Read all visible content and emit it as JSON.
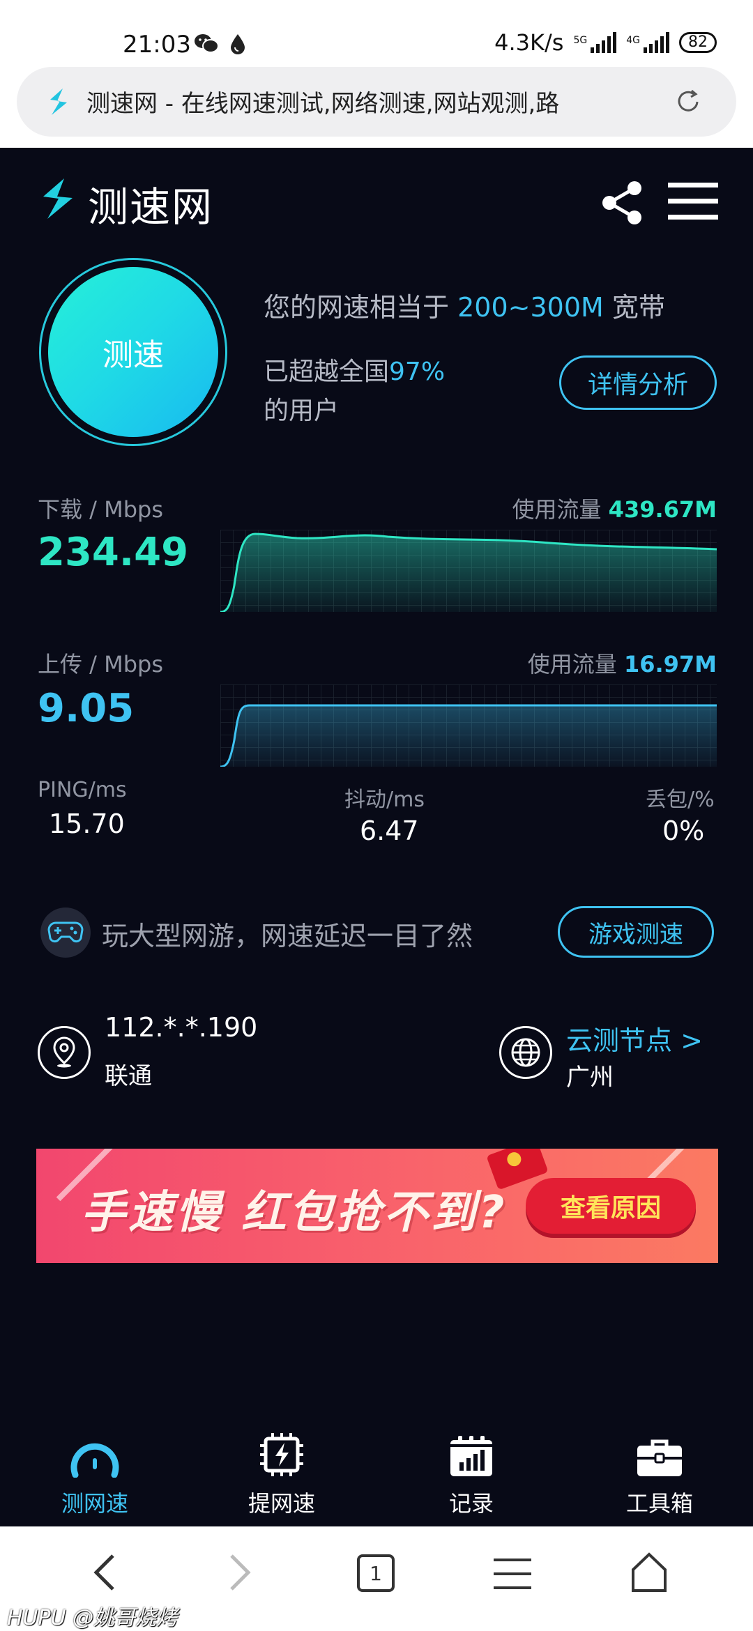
{
  "status_bar": {
    "time": "21:03",
    "net_speed": "4.3K/s",
    "sim1_label": "5G",
    "sim2_label": "4G",
    "battery": "82",
    "icons": [
      "wechat-icon",
      "drop-icon",
      "signal-icon",
      "battery-icon"
    ]
  },
  "browser": {
    "url_text": "测速网 - 在线网速测试,网络测速,网站观测,路",
    "icons": [
      "favicon",
      "reload-icon"
    ]
  },
  "header": {
    "brand": "测速网",
    "icons": [
      "share-icon",
      "menu-icon"
    ]
  },
  "speed_test": {
    "button_label": "测速",
    "equivalent_prefix": "您的网速相当于 ",
    "equivalent_value": "200~300M",
    "equivalent_suffix": " 宽带",
    "beat_prefix": "已超越全国",
    "beat_value": "97%",
    "beat_suffix": "的用户",
    "detail_button": "详情分析"
  },
  "download": {
    "label": "下载 / Mbps",
    "value": "234.49",
    "usage_label": "使用流量 ",
    "usage_value": "439.67M",
    "color": "#2ee6c4"
  },
  "upload": {
    "label": "上传 / Mbps",
    "value": "9.05",
    "usage_label": "使用流量 ",
    "usage_value": "16.97M",
    "color": "#3fc3f2"
  },
  "stats": {
    "ping_label": "PING/ms",
    "ping_value": "15.70",
    "jitter_label": "抖动/ms",
    "jitter_value": "6.47",
    "loss_label": "丢包/%",
    "loss_value": "0%"
  },
  "game": {
    "text": "玩大型网游，网速延迟一目了然",
    "button": "游戏测速",
    "icon": "gamepad-icon"
  },
  "location": {
    "ip": "112.*.*.190",
    "isp": "联通",
    "node_label": "云测节点 >",
    "city": "广州",
    "icons": [
      "location-pin-icon",
      "globe-icon"
    ]
  },
  "banner": {
    "text": "手速慢 红包抢不到?",
    "button": "查看原因"
  },
  "tabs": [
    {
      "label": "测网速",
      "icon": "speedometer-icon",
      "active": true
    },
    {
      "label": "提网速",
      "icon": "chip-bolt-icon",
      "active": false
    },
    {
      "label": "记录",
      "icon": "calendar-chart-icon",
      "active": false
    },
    {
      "label": "工具箱",
      "icon": "toolbox-icon",
      "active": false
    }
  ],
  "nav": {
    "tab_count": "1",
    "icons": [
      "back-icon",
      "forward-icon",
      "tabs-icon",
      "menu-lines-icon",
      "home-icon"
    ]
  },
  "watermark": "HUPU @姚哥烧烤",
  "colors": {
    "background": "#080a17",
    "accent_blue": "#3fc3f2",
    "accent_green": "#2ee6c4"
  }
}
